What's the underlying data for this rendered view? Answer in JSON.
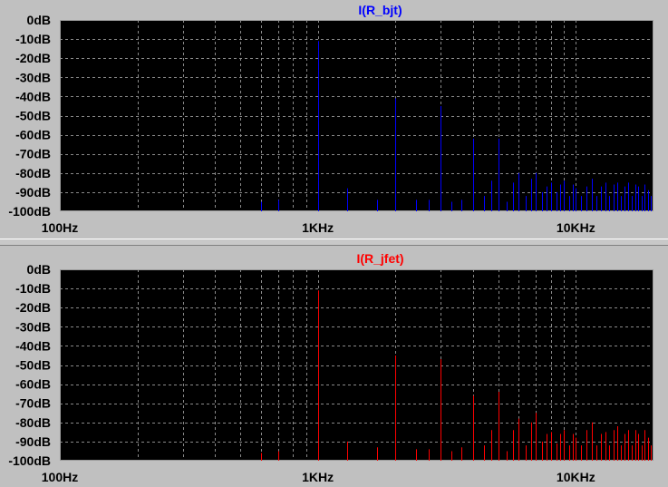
{
  "chart_data": [
    {
      "type": "bar",
      "title": "I(R_bjt)",
      "title_color": "#0000ff",
      "series_color": "#0000ff",
      "x_scale": "log",
      "xlim_hz": [
        100,
        20000
      ],
      "ylim_db": [
        -100,
        0
      ],
      "grid": true,
      "y_ticks": [
        "0dB",
        "-10dB",
        "-20dB",
        "-30dB",
        "-40dB",
        "-50dB",
        "-60dB",
        "-70dB",
        "-80dB",
        "-90dB",
        "-100dB"
      ],
      "x_ticks": [
        "100Hz",
        "1KHz",
        "10KHz"
      ],
      "x_tick_values": [
        100,
        1000,
        10000
      ],
      "spectral_lines": {
        "freq_hz": [
          600,
          700,
          1000,
          1300,
          1700,
          2000,
          2400,
          2700,
          3000,
          3300,
          3600,
          4000,
          4400,
          4700,
          5000,
          5400,
          5700,
          6000,
          6400,
          6700,
          7000,
          7400,
          7700,
          8000,
          8400,
          8700,
          9000,
          9400,
          9700,
          10000,
          10500,
          11000,
          11500,
          12000,
          12500,
          13000,
          13500,
          14000,
          14500,
          15000,
          15500,
          16000,
          16500,
          17000,
          17500,
          18000,
          18500,
          19000,
          19500
        ],
        "level_db": [
          -95,
          -94,
          -11,
          -88,
          -94,
          -41,
          -94,
          -94,
          -45,
          -95,
          -94,
          -62,
          -92,
          -84,
          -62,
          -95,
          -85,
          -80,
          -92,
          -83,
          -80,
          -90,
          -87,
          -85,
          -90,
          -86,
          -84,
          -92,
          -86,
          -88,
          -92,
          -87,
          -83,
          -92,
          -87,
          -85,
          -92,
          -86,
          -85,
          -92,
          -87,
          -85,
          -92,
          -86,
          -87,
          -92,
          -86,
          -89,
          -92
        ]
      }
    },
    {
      "type": "bar",
      "title": "I(R_jfet)",
      "title_color": "#ff0000",
      "series_color": "#ff0000",
      "x_scale": "log",
      "xlim_hz": [
        100,
        20000
      ],
      "ylim_db": [
        -100,
        0
      ],
      "grid": true,
      "y_ticks": [
        "0dB",
        "-10dB",
        "-20dB",
        "-30dB",
        "-40dB",
        "-50dB",
        "-60dB",
        "-70dB",
        "-80dB",
        "-90dB",
        "-100dB"
      ],
      "x_ticks": [
        "100Hz",
        "1KHz",
        "10KHz"
      ],
      "x_tick_values": [
        100,
        1000,
        10000
      ],
      "spectral_lines": {
        "freq_hz": [
          600,
          700,
          1000,
          1300,
          1700,
          2000,
          2400,
          2700,
          3000,
          3300,
          3600,
          4000,
          4400,
          4700,
          5000,
          5400,
          5700,
          6000,
          6400,
          6700,
          7000,
          7400,
          7700,
          8000,
          8400,
          8700,
          9000,
          9400,
          9700,
          10000,
          10500,
          11000,
          11500,
          12000,
          12500,
          13000,
          13500,
          14000,
          14500,
          15000,
          15500,
          16000,
          16500,
          17000,
          17500,
          18000,
          18500,
          19000,
          19500
        ],
        "level_db": [
          -96,
          -95,
          -11,
          -90,
          -93,
          -45,
          -94,
          -94,
          -47,
          -95,
          -93,
          -66,
          -92,
          -84,
          -64,
          -95,
          -84,
          -78,
          -92,
          -80,
          -75,
          -90,
          -86,
          -85,
          -91,
          -86,
          -84,
          -92,
          -86,
          -88,
          -92,
          -84,
          -80,
          -92,
          -86,
          -85,
          -92,
          -84,
          -82,
          -92,
          -86,
          -84,
          -92,
          -84,
          -86,
          -92,
          -84,
          -88,
          -92
        ]
      }
    }
  ]
}
